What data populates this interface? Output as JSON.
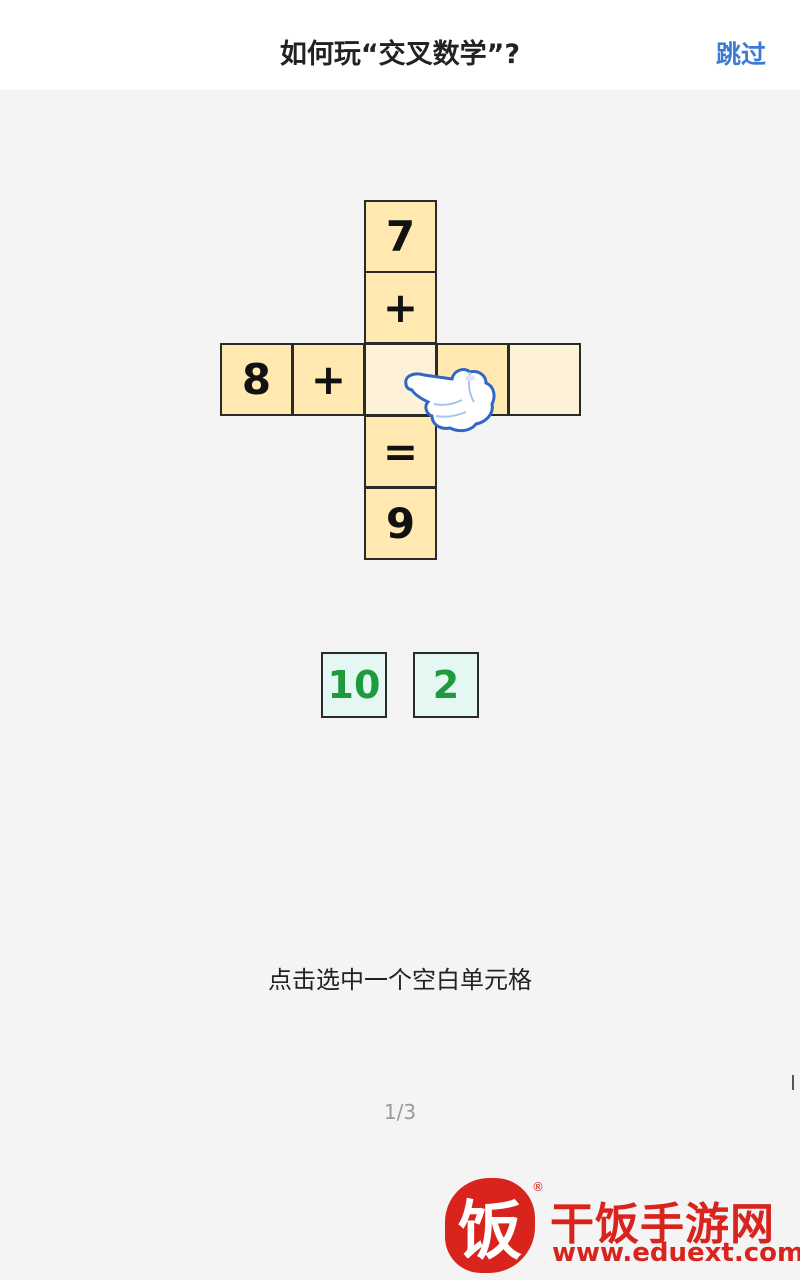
{
  "header": {
    "title": "如何玩“交叉数学”?",
    "skip_label": "跳过"
  },
  "puzzle": {
    "vertical": [
      "7",
      "+",
      "",
      "=",
      "9"
    ],
    "horizontal": [
      "8",
      "+",
      "",
      "",
      ""
    ],
    "choices": [
      "10",
      "2"
    ]
  },
  "instruction": "点击选中一个空白单元格",
  "pagination": "1/3",
  "watermark": {
    "logo_char": "饭",
    "registered": "®",
    "name": "干饭手游网",
    "url": "www.eduext.com"
  },
  "colors": {
    "cell_fill": "#ffe9b1",
    "empty_cell_fill": "#fdf2d8",
    "choice_fill": "#e4f7f2",
    "choice_text": "#1f9a3d",
    "accent": "#3b7bd6",
    "brand": "#d9231d"
  },
  "icons": {
    "pointer": "pointing-hand-icon"
  }
}
